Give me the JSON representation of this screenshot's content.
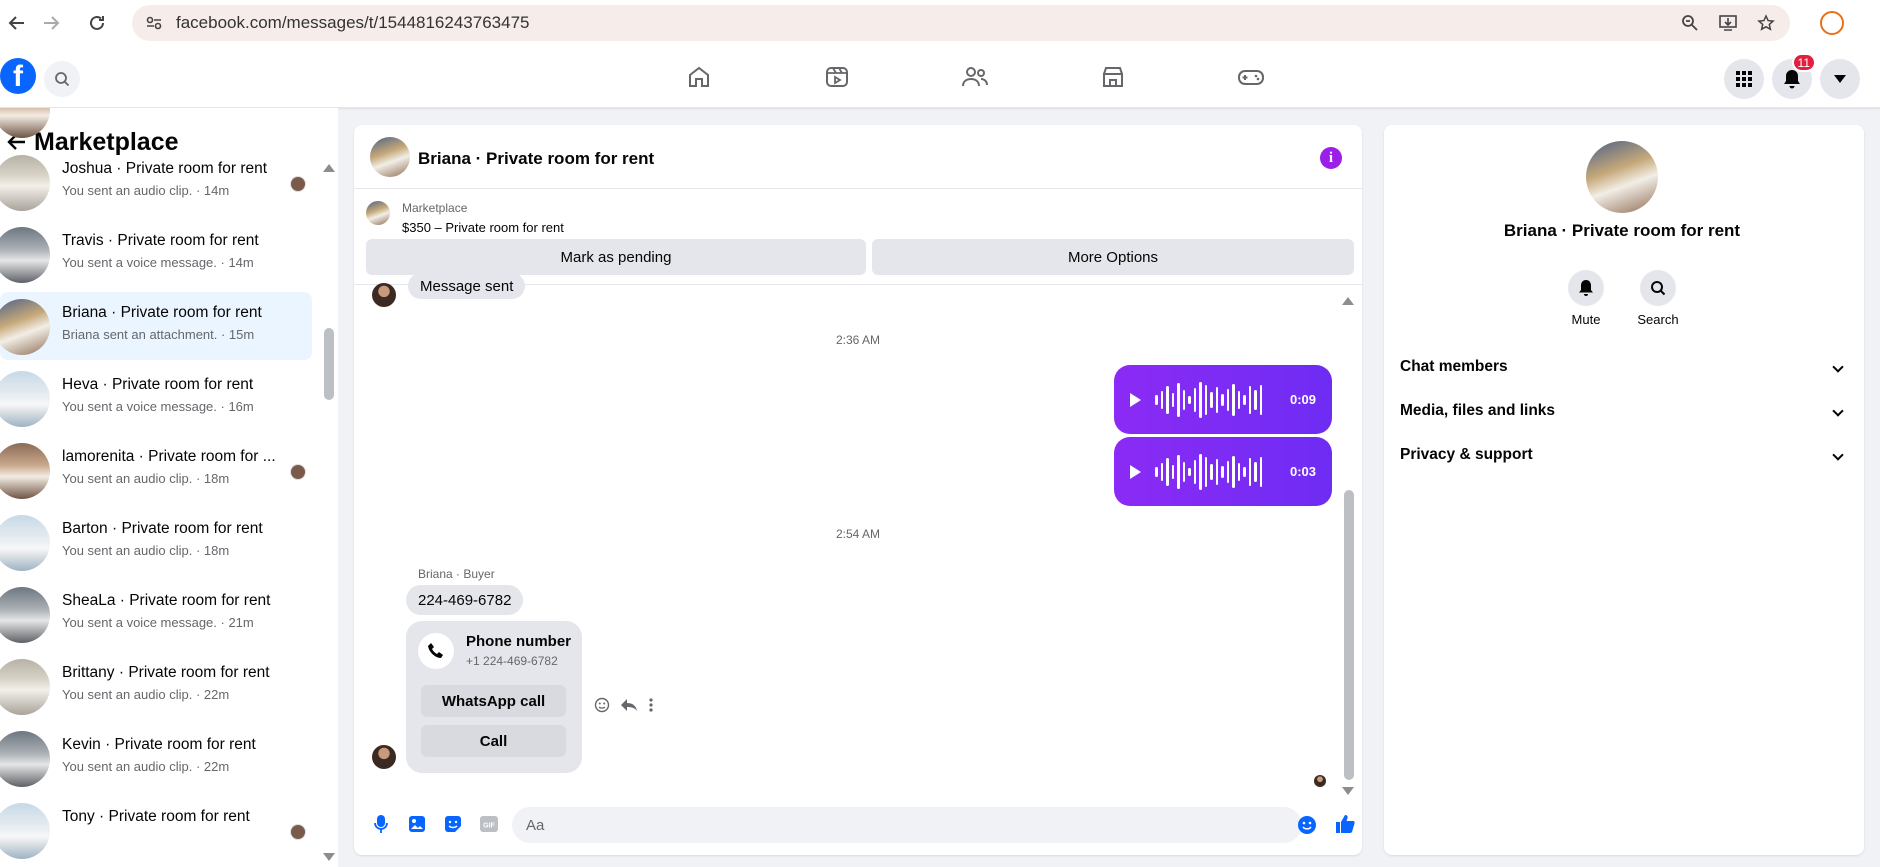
{
  "browser": {
    "url": "facebook.com/messages/t/1544816243763475"
  },
  "topbar": {
    "logo": "f",
    "notifications_count": "11",
    "nav_icons": [
      "home-icon",
      "reels-icon",
      "friends-icon",
      "marketplace-icon",
      "gaming-icon"
    ]
  },
  "sidebar": {
    "title": "Marketplace",
    "conversations": [
      {
        "name": "Joshua · Private room for rent",
        "sub": "You sent an audio clip. · 14m",
        "mini": true,
        "active": false
      },
      {
        "name": "Travis · Private room for rent",
        "sub": "You sent a voice message. · 14m",
        "mini": false,
        "active": false
      },
      {
        "name": "Briana · Private room for rent",
        "sub": "Briana sent an attachment. · 15m",
        "mini": false,
        "active": true
      },
      {
        "name": "Heva · Private room for rent",
        "sub": "You sent a voice message. · 16m",
        "mini": false,
        "active": false
      },
      {
        "name": "lamorenita · Private room for ...",
        "sub": "You sent an audio clip. · 18m",
        "mini": true,
        "active": false
      },
      {
        "name": "Barton · Private room for rent",
        "sub": "You sent an audio clip. · 18m",
        "mini": false,
        "active": false
      },
      {
        "name": "SheaLa · Private room for rent",
        "sub": "You sent a voice message. · 21m",
        "mini": false,
        "active": false
      },
      {
        "name": "Brittany · Private room for rent",
        "sub": "You sent an audio clip. · 22m",
        "mini": false,
        "active": false
      },
      {
        "name": "Kevin · Private room for rent",
        "sub": "You sent an audio clip. · 22m",
        "mini": false,
        "active": false
      },
      {
        "name": "Tony · Private room for rent",
        "sub": "",
        "mini": true,
        "active": false
      }
    ]
  },
  "chat": {
    "title": "Briana · Private room for rent",
    "marketplace_label": "Marketplace",
    "listing": "$350 – Private room for rent",
    "mark_pending": "Mark as pending",
    "more_options": "More Options",
    "prev_message": "Message sent",
    "time1": "2:36 AM",
    "audio1_duration": "0:09",
    "audio2_duration": "0:03",
    "time2": "2:54 AM",
    "sender_label": "Briana · Buyer",
    "phone_message": "224-469-6782",
    "contact_title": "Phone number",
    "contact_number": "+1 224-469-6782",
    "whatsapp_label": "WhatsApp call",
    "call_label": "Call",
    "composer_placeholder": "Aa"
  },
  "details": {
    "name": "Briana · Private room for rent",
    "mute_label": "Mute",
    "search_label": "Search",
    "sections": [
      "Chat members",
      "Media, files and links",
      "Privacy & support"
    ]
  },
  "colors": {
    "brand": "#0866ff",
    "accent": "#9b1fe8",
    "active_row": "#ebf5ff"
  }
}
